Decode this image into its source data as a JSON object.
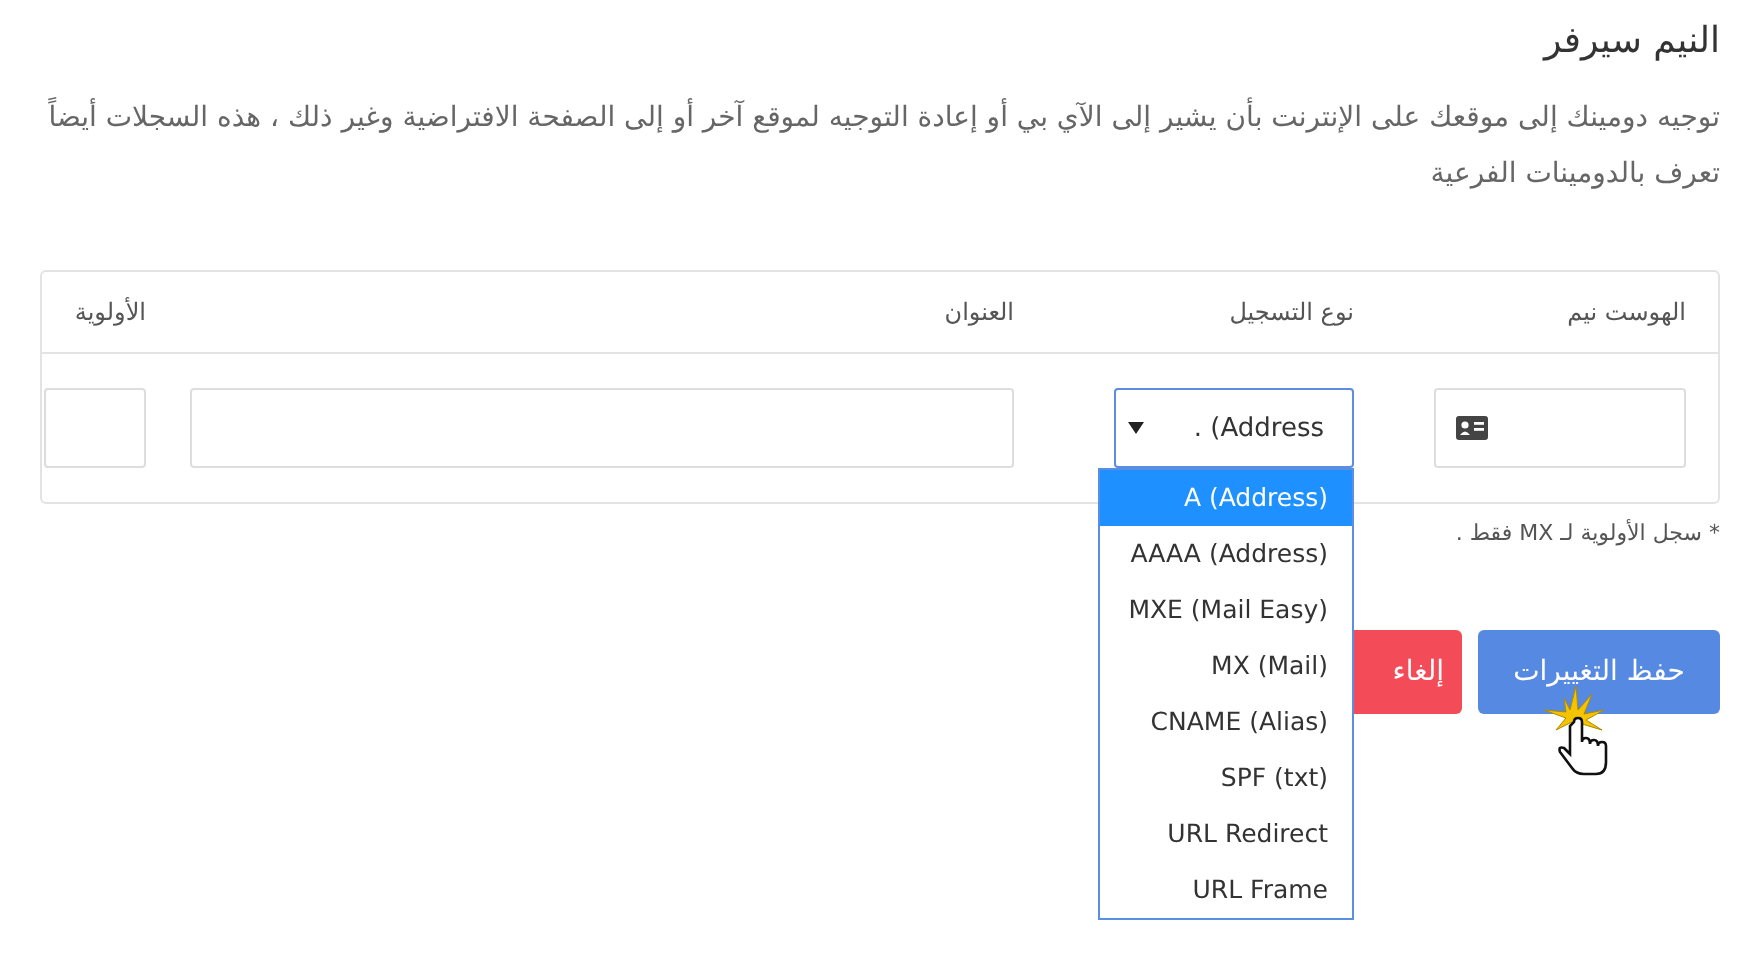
{
  "title": "النيم سيرفر",
  "description": "توجيه دومينك إلى موقعك على الإنترنت بأن يشير إلى الآي بي أو إعادة التوجيه لموقع آخر أو إلى الصفحة الافتراضية وغير ذلك ، هذه السجلات أيضاً تعرف بالدومينات الفرعية",
  "table": {
    "columns": [
      "الهوست نيم",
      "نوع التسجيل",
      "العنوان",
      "الأولوية"
    ],
    "row": {
      "type_display": ". (Address"
    }
  },
  "type_dropdown": {
    "options": [
      {
        "label": "A (Address)",
        "selected": true
      },
      {
        "label": "AAAA (Address)",
        "selected": false
      },
      {
        "label": "MXE (Mail Easy)",
        "selected": false
      },
      {
        "label": "MX (Mail)",
        "selected": false
      },
      {
        "label": "CNAME (Alias)",
        "selected": false
      },
      {
        "label": "SPF (txt)",
        "selected": false
      },
      {
        "label": "URL Redirect",
        "selected": false
      },
      {
        "label": "URL Frame",
        "selected": false
      }
    ]
  },
  "note": "* سجل الأولوية لـ MX فقط .",
  "buttons": [
    {
      "label": "حفظ التغييرات",
      "kind": "primary"
    },
    {
      "label": "إلغاء",
      "kind": "danger"
    }
  ]
}
